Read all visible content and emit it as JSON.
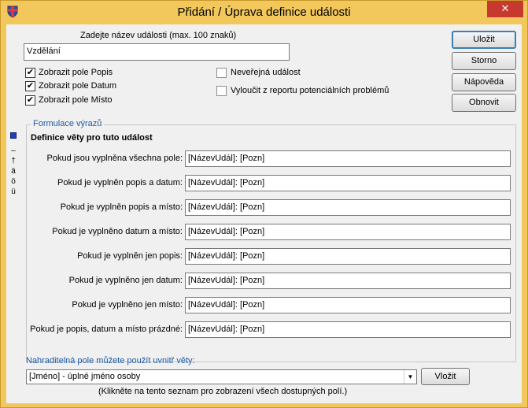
{
  "window": {
    "title": "Přidání / Úprava definice události",
    "close_glyph": "✕"
  },
  "event_name": {
    "label": "Zadejte název události (max. 100 znaků)",
    "value": "Vzdělání"
  },
  "checkboxes": {
    "show_desc": {
      "label": "Zobrazit pole Popis",
      "checked": true
    },
    "show_date": {
      "label": "Zobrazit pole Datum",
      "checked": true
    },
    "show_place": {
      "label": "Zobrazit pole Místo",
      "checked": true
    },
    "private_event": {
      "label": "Neveřejná událost",
      "checked": false
    },
    "exclude_report": {
      "label": "Vyloučit z reportu potenciálních problémů",
      "checked": false
    }
  },
  "check_mark": "✔",
  "buttons": {
    "save": "Uložit",
    "cancel": "Storno",
    "help": "Nápověda",
    "refresh": "Obnovit",
    "insert": "Vložit"
  },
  "side_chars": [
    "–",
    "†",
    "ä",
    "ö",
    "ü"
  ],
  "expressions": {
    "group_title": "Formulace výrazů",
    "heading": "Definice věty pro tuto událost",
    "rows": [
      {
        "label": "Pokud jsou vyplněna všechna pole:",
        "value": "[NázevUdál]: [Pozn]"
      },
      {
        "label": "Pokud je vyplněn popis a datum:",
        "value": "[NázevUdál]: [Pozn]"
      },
      {
        "label": "Pokud je vyplněn popis a místo:",
        "value": "[NázevUdál]: [Pozn]"
      },
      {
        "label": "Pokud je vyplněno datum a místo:",
        "value": "[NázevUdál]: [Pozn]"
      },
      {
        "label": "Pokud je vyplněn jen popis:",
        "value": "[NázevUdál]: [Pozn]"
      },
      {
        "label": "Pokud je vyplněno jen datum:",
        "value": "[NázevUdál]: [Pozn]"
      },
      {
        "label": "Pokud je vyplněno jen místo:",
        "value": "[NázevUdál]: [Pozn]"
      },
      {
        "label": "Pokud je popis, datum a místo prázdné:",
        "value": "[NázevUdál]: [Pozn]"
      }
    ]
  },
  "placeholders": {
    "label": "Nahraditelná pole můžete použít uvnitř věty:",
    "selected": "[Jméno] - úplné jméno osoby",
    "hint": "(Klikněte na tento seznam pro zobrazení všech dostupných polí.)"
  }
}
